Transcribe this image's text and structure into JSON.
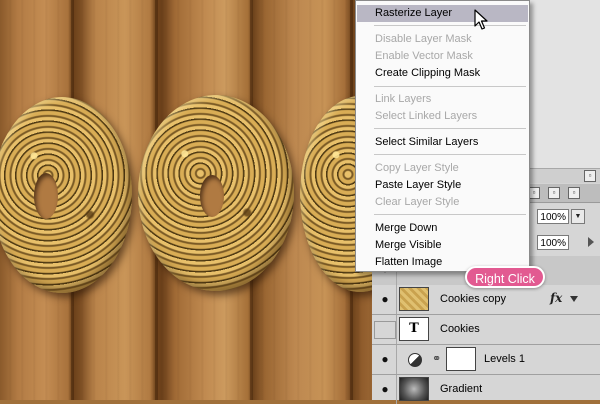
{
  "context_menu": {
    "groups": [
      [
        {
          "label": "Rasterize Layer",
          "enabled": true,
          "highlighted": true
        }
      ],
      [
        {
          "label": "Disable Layer Mask",
          "enabled": false
        },
        {
          "label": "Enable Vector Mask",
          "enabled": false
        },
        {
          "label": "Create Clipping Mask",
          "enabled": true
        }
      ],
      [
        {
          "label": "Link Layers",
          "enabled": false
        },
        {
          "label": "Select Linked Layers",
          "enabled": false
        }
      ],
      [
        {
          "label": "Select Similar Layers",
          "enabled": true
        }
      ],
      [
        {
          "label": "Copy Layer Style",
          "enabled": false
        },
        {
          "label": "Paste Layer Style",
          "enabled": true
        },
        {
          "label": "Clear Layer Style",
          "enabled": false
        }
      ],
      [
        {
          "label": "Merge Down",
          "enabled": true
        },
        {
          "label": "Merge Visible",
          "enabled": true
        },
        {
          "label": "Flatten Image",
          "enabled": true
        }
      ]
    ]
  },
  "layers_panel": {
    "opacity": "100%",
    "fill": "100%",
    "layers": [
      {
        "name": "Cookies copy",
        "visible": true,
        "thumbnail": "pattern",
        "fx": "fx"
      },
      {
        "name": "Cookies",
        "visible": false,
        "thumbnail": "text-layer-icon",
        "thumb_text": "T"
      },
      {
        "name": "Levels 1",
        "visible": true,
        "thumbnail": "adjustment-mask"
      },
      {
        "name": "Gradient",
        "visible": true,
        "thumbnail": "gradient"
      }
    ]
  },
  "annotation": {
    "text": "Right Click",
    "color": "#e25a91"
  },
  "colors": {
    "menu_highlight": "#b9b7c4",
    "disabled_text": "#a8a8a8",
    "panel_bg": "#d6d6d6"
  }
}
